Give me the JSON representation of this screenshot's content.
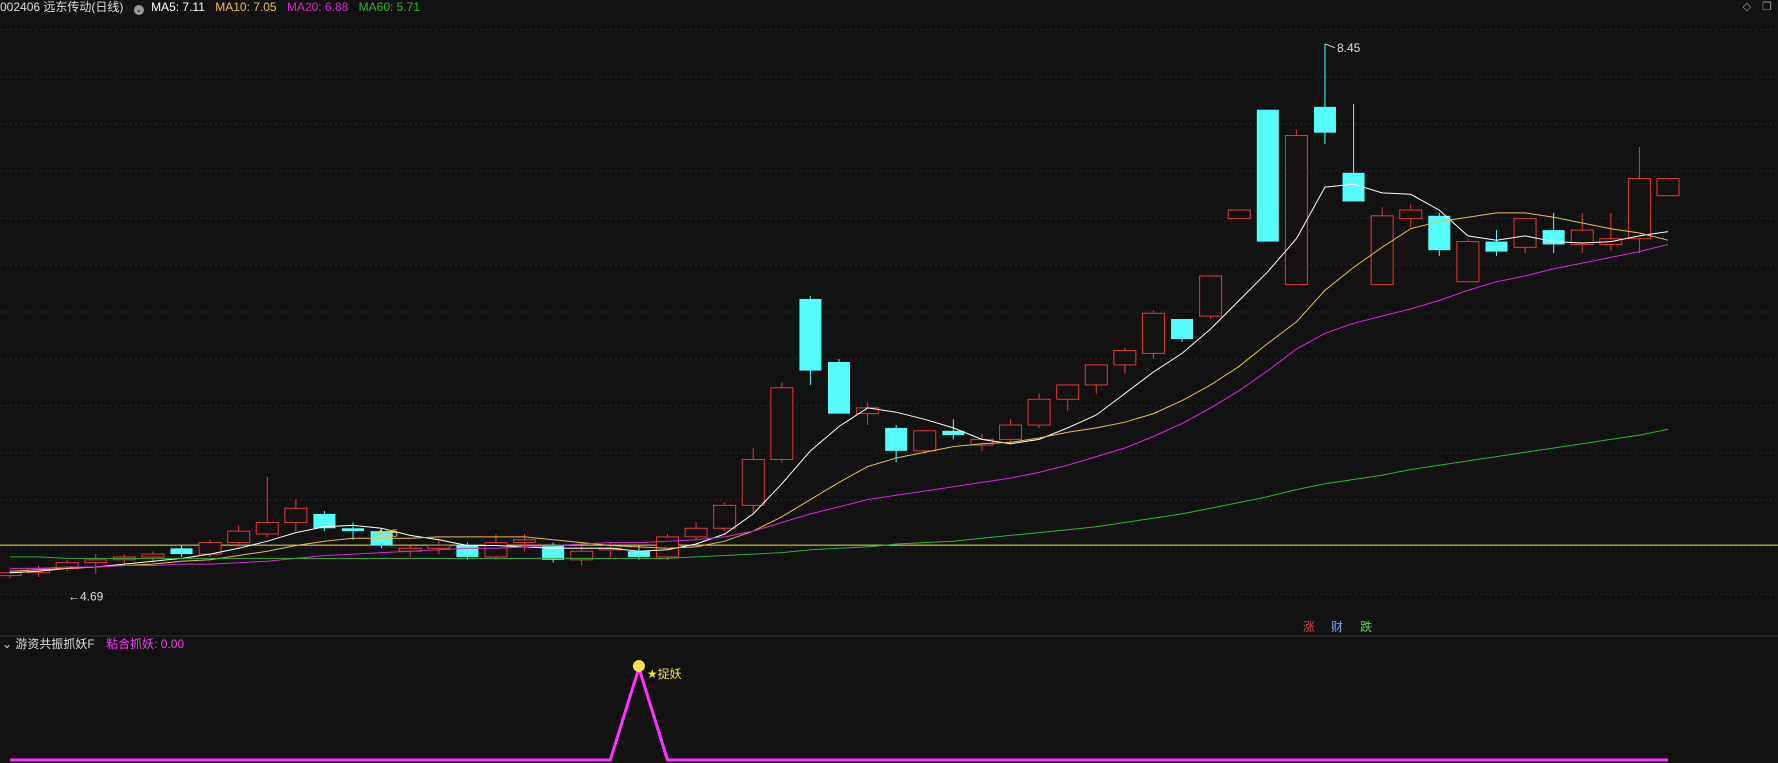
{
  "header": {
    "stock": "002406 远东传动(日线)",
    "ma5": "MA5: 7.11",
    "ma10": "MA10: 7.05",
    "ma20": "MA20: 6.88",
    "ma60": "MA60: 5.71"
  },
  "indicator": {
    "name": "游资共振抓妖F",
    "value_label": "粘合抓妖: 0.00",
    "signal_text": "★捉妖"
  },
  "markers": {
    "up": "涨",
    "fin": "财",
    "down": "跌"
  },
  "annotations": {
    "high": "8.45",
    "low": "←4.69",
    "mid": "4.95"
  },
  "colors": {
    "bg": "#131212",
    "up": "#e03a3a",
    "down": "#54fcfc",
    "ma5": "#ffffff",
    "ma10": "#e6c04a",
    "ma20": "#d42ad4",
    "ma60": "#2fb32f",
    "indicator": "#ff33ff"
  },
  "chart_data": {
    "type": "candlestick",
    "ylim": [
      4.4,
      8.6
    ],
    "ohlc": [
      [
        4.71,
        4.75,
        4.69,
        4.73
      ],
      [
        4.73,
        4.78,
        4.7,
        4.76
      ],
      [
        4.76,
        4.82,
        4.74,
        4.8
      ],
      [
        4.8,
        4.86,
        4.72,
        4.82
      ],
      [
        4.82,
        4.86,
        4.78,
        4.84
      ],
      [
        4.84,
        4.88,
        4.8,
        4.86
      ],
      [
        4.9,
        4.92,
        4.84,
        4.86
      ],
      [
        4.86,
        4.96,
        4.84,
        4.94
      ],
      [
        4.94,
        5.06,
        4.9,
        5.02
      ],
      [
        5.0,
        5.4,
        4.98,
        5.08
      ],
      [
        5.08,
        5.24,
        5.02,
        5.18
      ],
      [
        5.14,
        5.16,
        5.02,
        5.04
      ],
      [
        5.04,
        5.08,
        4.96,
        5.02
      ],
      [
        5.02,
        5.04,
        4.9,
        4.92
      ],
      [
        4.88,
        4.92,
        4.84,
        4.9
      ],
      [
        4.9,
        4.96,
        4.86,
        4.92
      ],
      [
        4.92,
        4.94,
        4.82,
        4.84
      ],
      [
        4.84,
        5.0,
        4.82,
        4.94
      ],
      [
        4.94,
        5.0,
        4.88,
        4.96
      ],
      [
        4.92,
        4.94,
        4.8,
        4.82
      ],
      [
        4.82,
        4.92,
        4.78,
        4.88
      ],
      [
        4.9,
        4.94,
        4.84,
        4.9
      ],
      [
        4.88,
        4.92,
        4.82,
        4.84
      ],
      [
        4.84,
        5.0,
        4.82,
        4.98
      ],
      [
        4.98,
        5.08,
        4.96,
        5.04
      ],
      [
        5.04,
        5.22,
        5.02,
        5.2
      ],
      [
        5.2,
        5.6,
        5.14,
        5.52
      ],
      [
        5.52,
        6.06,
        5.5,
        6.02
      ],
      [
        6.64,
        6.66,
        6.04,
        6.14
      ],
      [
        6.2,
        6.22,
        5.84,
        5.84
      ],
      [
        5.84,
        5.92,
        5.76,
        5.88
      ],
      [
        5.74,
        5.76,
        5.5,
        5.58
      ],
      [
        5.58,
        5.72,
        5.56,
        5.72
      ],
      [
        5.72,
        5.8,
        5.66,
        5.69
      ],
      [
        5.62,
        5.7,
        5.58,
        5.66
      ],
      [
        5.66,
        5.8,
        5.64,
        5.76
      ],
      [
        5.76,
        5.98,
        5.74,
        5.94
      ],
      [
        5.94,
        6.04,
        5.86,
        6.04
      ],
      [
        6.04,
        6.18,
        5.98,
        6.18
      ],
      [
        6.18,
        6.3,
        6.12,
        6.28
      ],
      [
        6.26,
        6.56,
        6.22,
        6.54
      ],
      [
        6.5,
        6.5,
        6.34,
        6.36
      ],
      [
        6.52,
        6.8,
        6.5,
        6.8
      ],
      [
        7.2,
        7.26,
        7.26,
        7.26
      ],
      [
        7.96,
        7.96,
        7.04,
        7.04
      ],
      [
        6.74,
        7.82,
        6.74,
        7.78
      ],
      [
        7.98,
        8.42,
        7.72,
        7.8
      ],
      [
        7.52,
        8.0,
        7.32,
        7.32
      ],
      [
        6.74,
        7.28,
        6.74,
        7.22
      ],
      [
        7.2,
        7.3,
        7.14,
        7.26
      ],
      [
        7.22,
        7.24,
        6.94,
        6.98
      ],
      [
        6.76,
        7.06,
        6.76,
        7.04
      ],
      [
        7.04,
        7.12,
        6.94,
        6.97
      ],
      [
        7.0,
        7.2,
        6.96,
        7.2
      ],
      [
        7.12,
        7.24,
        6.96,
        7.02
      ],
      [
        7.02,
        7.24,
        6.96,
        7.12
      ],
      [
        7.02,
        7.24,
        6.98,
        7.06
      ],
      [
        7.06,
        7.7,
        6.96,
        7.48
      ],
      [
        7.36,
        7.36,
        7.38,
        7.48
      ]
    ],
    "ma5": [
      4.73,
      4.74,
      4.76,
      4.77,
      4.79,
      4.81,
      4.83,
      4.86,
      4.9,
      4.95,
      5.01,
      5.05,
      5.06,
      5.04,
      4.99,
      4.96,
      4.92,
      4.92,
      4.91,
      4.9,
      4.9,
      4.9,
      4.88,
      4.89,
      4.93,
      5.0,
      5.14,
      5.35,
      5.58,
      5.75,
      5.88,
      5.85,
      5.8,
      5.74,
      5.66,
      5.63,
      5.66,
      5.74,
      5.83,
      5.98,
      6.13,
      6.26,
      6.43,
      6.63,
      6.83,
      7.06,
      7.42,
      7.44,
      7.38,
      7.37,
      7.26,
      7.08,
      7.05,
      7.08,
      7.04,
      7.03,
      7.04,
      7.08,
      7.11
    ],
    "ma10": [
      4.74,
      4.75,
      4.76,
      4.77,
      4.78,
      4.79,
      4.81,
      4.82,
      4.85,
      4.88,
      4.92,
      4.95,
      4.97,
      4.97,
      4.97,
      4.98,
      4.98,
      4.98,
      4.98,
      4.96,
      4.94,
      4.92,
      4.91,
      4.9,
      4.91,
      4.95,
      5.02,
      5.12,
      5.24,
      5.36,
      5.47,
      5.53,
      5.57,
      5.61,
      5.63,
      5.64,
      5.67,
      5.71,
      5.74,
      5.78,
      5.84,
      5.93,
      6.04,
      6.17,
      6.33,
      6.48,
      6.7,
      6.86,
      7.0,
      7.13,
      7.18,
      7.21,
      7.24,
      7.24,
      7.21,
      7.17,
      7.13,
      7.1,
      7.05
    ],
    "ma20": [
      4.76,
      4.76,
      4.77,
      4.77,
      4.78,
      4.78,
      4.79,
      4.79,
      4.8,
      4.81,
      4.83,
      4.85,
      4.86,
      4.87,
      4.88,
      4.89,
      4.9,
      4.9,
      4.91,
      4.92,
      4.93,
      4.94,
      4.94,
      4.95,
      4.96,
      4.98,
      5.02,
      5.08,
      5.14,
      5.19,
      5.24,
      5.27,
      5.3,
      5.33,
      5.36,
      5.39,
      5.43,
      5.48,
      5.54,
      5.6,
      5.68,
      5.77,
      5.88,
      6.0,
      6.14,
      6.29,
      6.4,
      6.47,
      6.52,
      6.57,
      6.63,
      6.7,
      6.76,
      6.8,
      6.85,
      6.89,
      6.93,
      6.97,
      7.02
    ],
    "ma60": [
      4.84,
      4.84,
      4.83,
      4.83,
      4.83,
      4.83,
      4.83,
      4.83,
      4.83,
      4.83,
      4.83,
      4.83,
      4.83,
      4.83,
      4.83,
      4.83,
      4.83,
      4.83,
      4.83,
      4.83,
      4.83,
      4.83,
      4.83,
      4.83,
      4.84,
      4.85,
      4.86,
      4.87,
      4.89,
      4.9,
      4.91,
      4.93,
      4.94,
      4.95,
      4.97,
      4.99,
      5.01,
      5.03,
      5.05,
      5.08,
      5.11,
      5.14,
      5.18,
      5.22,
      5.26,
      5.31,
      5.35,
      5.38,
      5.41,
      5.45,
      5.48,
      5.51,
      5.54,
      5.57,
      5.6,
      5.63,
      5.66,
      5.69,
      5.73
    ],
    "baseline_price": 4.95,
    "indicator_series": [
      0,
      0,
      0,
      0,
      0,
      0,
      0,
      0,
      0,
      0,
      0,
      0,
      0,
      0,
      0,
      0,
      0,
      0,
      0,
      0,
      0,
      0,
      1,
      0,
      0,
      0,
      0,
      0,
      0,
      0,
      0,
      0,
      0,
      0,
      0,
      0,
      0,
      0,
      0,
      0,
      0,
      0,
      0,
      0,
      0,
      0,
      0,
      0,
      0,
      0,
      0,
      0,
      0,
      0,
      0,
      0,
      0,
      0,
      0
    ]
  }
}
